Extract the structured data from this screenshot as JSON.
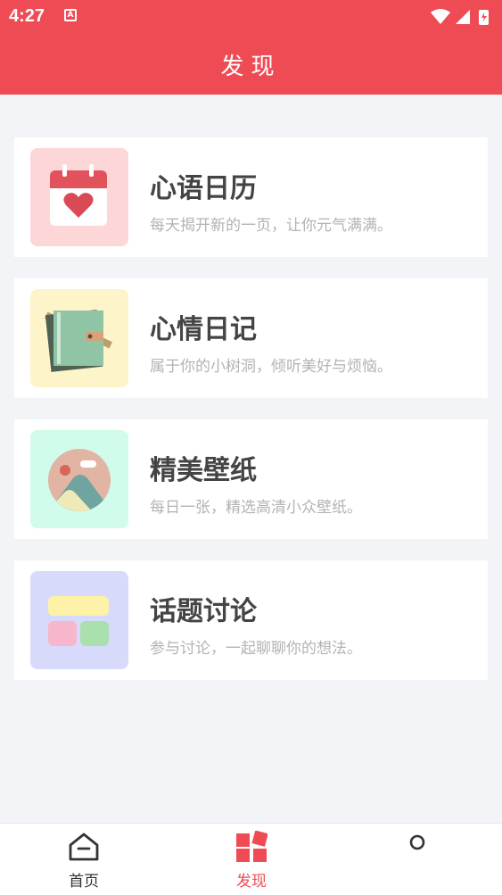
{
  "status": {
    "time": "4:27",
    "notification_icon": "A"
  },
  "header": {
    "title": "发现"
  },
  "cards": [
    {
      "title": "心语日历",
      "desc": "每天揭开新的一页，让你元气满满。",
      "icon": "calendar-heart-icon",
      "bg": "#fdd6d8"
    },
    {
      "title": "心情日记",
      "desc": "属于你的小树洞，倾听美好与烦恼。",
      "icon": "diary-book-icon",
      "bg": "#fdf5c9"
    },
    {
      "title": "精美壁纸",
      "desc": "每日一张，精选高清小众壁纸。",
      "icon": "landscape-image-icon",
      "bg": "#d1fbeb"
    },
    {
      "title": "话题讨论",
      "desc": "参与讨论，一起聊聊你的想法。",
      "icon": "topic-blocks-icon",
      "bg": "#d8dafb"
    }
  ],
  "bottom_nav": {
    "home_label": "首页",
    "discover_label": "发现",
    "active_color": "#ef4b55",
    "inactive_color": "#333333"
  }
}
